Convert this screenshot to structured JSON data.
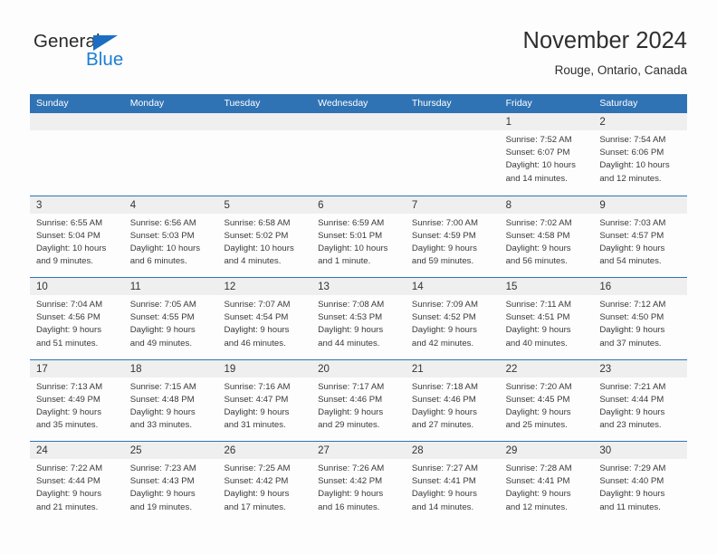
{
  "brand": {
    "name_part1": "General",
    "name_part2": "Blue",
    "logo_icon": "triangle-logo-icon",
    "accent_color": "#1b7fd4"
  },
  "header": {
    "title": "November 2024",
    "subtitle": "Rouge, Ontario, Canada"
  },
  "theme": {
    "header_blue": "#3073b4",
    "day_band_gray": "#efefef",
    "text_color": "#3a3a3a"
  },
  "weekdays": [
    "Sunday",
    "Monday",
    "Tuesday",
    "Wednesday",
    "Thursday",
    "Friday",
    "Saturday"
  ],
  "weeks": [
    [
      {
        "day": "",
        "empty": true
      },
      {
        "day": "",
        "empty": true
      },
      {
        "day": "",
        "empty": true
      },
      {
        "day": "",
        "empty": true
      },
      {
        "day": "",
        "empty": true
      },
      {
        "day": "1",
        "sunrise": "Sunrise: 7:52 AM",
        "sunset": "Sunset: 6:07 PM",
        "daylight1": "Daylight: 10 hours",
        "daylight2": "and 14 minutes."
      },
      {
        "day": "2",
        "sunrise": "Sunrise: 7:54 AM",
        "sunset": "Sunset: 6:06 PM",
        "daylight1": "Daylight: 10 hours",
        "daylight2": "and 12 minutes."
      }
    ],
    [
      {
        "day": "3",
        "sunrise": "Sunrise: 6:55 AM",
        "sunset": "Sunset: 5:04 PM",
        "daylight1": "Daylight: 10 hours",
        "daylight2": "and 9 minutes."
      },
      {
        "day": "4",
        "sunrise": "Sunrise: 6:56 AM",
        "sunset": "Sunset: 5:03 PM",
        "daylight1": "Daylight: 10 hours",
        "daylight2": "and 6 minutes."
      },
      {
        "day": "5",
        "sunrise": "Sunrise: 6:58 AM",
        "sunset": "Sunset: 5:02 PM",
        "daylight1": "Daylight: 10 hours",
        "daylight2": "and 4 minutes."
      },
      {
        "day": "6",
        "sunrise": "Sunrise: 6:59 AM",
        "sunset": "Sunset: 5:01 PM",
        "daylight1": "Daylight: 10 hours",
        "daylight2": "and 1 minute."
      },
      {
        "day": "7",
        "sunrise": "Sunrise: 7:00 AM",
        "sunset": "Sunset: 4:59 PM",
        "daylight1": "Daylight: 9 hours",
        "daylight2": "and 59 minutes."
      },
      {
        "day": "8",
        "sunrise": "Sunrise: 7:02 AM",
        "sunset": "Sunset: 4:58 PM",
        "daylight1": "Daylight: 9 hours",
        "daylight2": "and 56 minutes."
      },
      {
        "day": "9",
        "sunrise": "Sunrise: 7:03 AM",
        "sunset": "Sunset: 4:57 PM",
        "daylight1": "Daylight: 9 hours",
        "daylight2": "and 54 minutes."
      }
    ],
    [
      {
        "day": "10",
        "sunrise": "Sunrise: 7:04 AM",
        "sunset": "Sunset: 4:56 PM",
        "daylight1": "Daylight: 9 hours",
        "daylight2": "and 51 minutes."
      },
      {
        "day": "11",
        "sunrise": "Sunrise: 7:05 AM",
        "sunset": "Sunset: 4:55 PM",
        "daylight1": "Daylight: 9 hours",
        "daylight2": "and 49 minutes."
      },
      {
        "day": "12",
        "sunrise": "Sunrise: 7:07 AM",
        "sunset": "Sunset: 4:54 PM",
        "daylight1": "Daylight: 9 hours",
        "daylight2": "and 46 minutes."
      },
      {
        "day": "13",
        "sunrise": "Sunrise: 7:08 AM",
        "sunset": "Sunset: 4:53 PM",
        "daylight1": "Daylight: 9 hours",
        "daylight2": "and 44 minutes."
      },
      {
        "day": "14",
        "sunrise": "Sunrise: 7:09 AM",
        "sunset": "Sunset: 4:52 PM",
        "daylight1": "Daylight: 9 hours",
        "daylight2": "and 42 minutes."
      },
      {
        "day": "15",
        "sunrise": "Sunrise: 7:11 AM",
        "sunset": "Sunset: 4:51 PM",
        "daylight1": "Daylight: 9 hours",
        "daylight2": "and 40 minutes."
      },
      {
        "day": "16",
        "sunrise": "Sunrise: 7:12 AM",
        "sunset": "Sunset: 4:50 PM",
        "daylight1": "Daylight: 9 hours",
        "daylight2": "and 37 minutes."
      }
    ],
    [
      {
        "day": "17",
        "sunrise": "Sunrise: 7:13 AM",
        "sunset": "Sunset: 4:49 PM",
        "daylight1": "Daylight: 9 hours",
        "daylight2": "and 35 minutes."
      },
      {
        "day": "18",
        "sunrise": "Sunrise: 7:15 AM",
        "sunset": "Sunset: 4:48 PM",
        "daylight1": "Daylight: 9 hours",
        "daylight2": "and 33 minutes."
      },
      {
        "day": "19",
        "sunrise": "Sunrise: 7:16 AM",
        "sunset": "Sunset: 4:47 PM",
        "daylight1": "Daylight: 9 hours",
        "daylight2": "and 31 minutes."
      },
      {
        "day": "20",
        "sunrise": "Sunrise: 7:17 AM",
        "sunset": "Sunset: 4:46 PM",
        "daylight1": "Daylight: 9 hours",
        "daylight2": "and 29 minutes."
      },
      {
        "day": "21",
        "sunrise": "Sunrise: 7:18 AM",
        "sunset": "Sunset: 4:46 PM",
        "daylight1": "Daylight: 9 hours",
        "daylight2": "and 27 minutes."
      },
      {
        "day": "22",
        "sunrise": "Sunrise: 7:20 AM",
        "sunset": "Sunset: 4:45 PM",
        "daylight1": "Daylight: 9 hours",
        "daylight2": "and 25 minutes."
      },
      {
        "day": "23",
        "sunrise": "Sunrise: 7:21 AM",
        "sunset": "Sunset: 4:44 PM",
        "daylight1": "Daylight: 9 hours",
        "daylight2": "and 23 minutes."
      }
    ],
    [
      {
        "day": "24",
        "sunrise": "Sunrise: 7:22 AM",
        "sunset": "Sunset: 4:44 PM",
        "daylight1": "Daylight: 9 hours",
        "daylight2": "and 21 minutes."
      },
      {
        "day": "25",
        "sunrise": "Sunrise: 7:23 AM",
        "sunset": "Sunset: 4:43 PM",
        "daylight1": "Daylight: 9 hours",
        "daylight2": "and 19 minutes."
      },
      {
        "day": "26",
        "sunrise": "Sunrise: 7:25 AM",
        "sunset": "Sunset: 4:42 PM",
        "daylight1": "Daylight: 9 hours",
        "daylight2": "and 17 minutes."
      },
      {
        "day": "27",
        "sunrise": "Sunrise: 7:26 AM",
        "sunset": "Sunset: 4:42 PM",
        "daylight1": "Daylight: 9 hours",
        "daylight2": "and 16 minutes."
      },
      {
        "day": "28",
        "sunrise": "Sunrise: 7:27 AM",
        "sunset": "Sunset: 4:41 PM",
        "daylight1": "Daylight: 9 hours",
        "daylight2": "and 14 minutes."
      },
      {
        "day": "29",
        "sunrise": "Sunrise: 7:28 AM",
        "sunset": "Sunset: 4:41 PM",
        "daylight1": "Daylight: 9 hours",
        "daylight2": "and 12 minutes."
      },
      {
        "day": "30",
        "sunrise": "Sunrise: 7:29 AM",
        "sunset": "Sunset: 4:40 PM",
        "daylight1": "Daylight: 9 hours",
        "daylight2": "and 11 minutes."
      }
    ]
  ]
}
